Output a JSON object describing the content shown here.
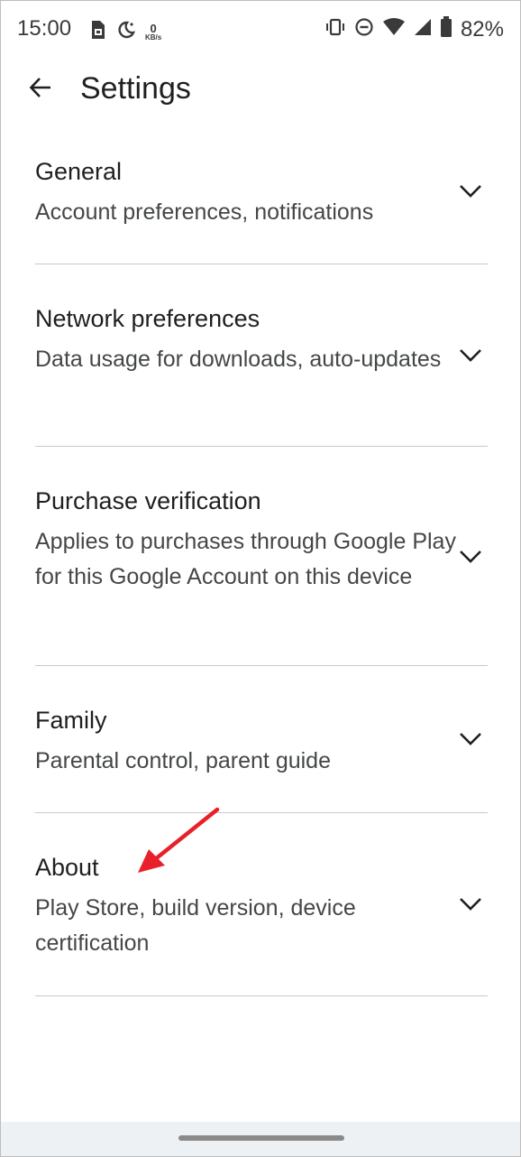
{
  "status_bar": {
    "time": "15:00",
    "net_speed_value": "0",
    "net_speed_unit": "KB/s",
    "battery_percent": "82%",
    "icons": [
      "sim-card-icon",
      "do-not-disturb-moon-icon",
      "vibrate-icon",
      "dnd-minus-icon",
      "wifi-icon",
      "cell-signal-icon",
      "battery-icon"
    ]
  },
  "app_bar": {
    "title": "Settings",
    "back_icon": "arrow-left-icon"
  },
  "sections": [
    {
      "title": "General",
      "subtitle": "Account preferences, notifications"
    },
    {
      "title": "Network preferences",
      "subtitle": "Data usage for downloads, auto-updates"
    },
    {
      "title": "Purchase verification",
      "subtitle": "Applies to purchases through Google Play for this Google Account on this device"
    },
    {
      "title": "Family",
      "subtitle": "Parental control, parent guide"
    },
    {
      "title": "About",
      "subtitle": "Play Store, build version, device certification"
    }
  ],
  "colors": {
    "annotation_arrow": "#e8202a",
    "divider": "#c8c8c8",
    "subtitle_text": "#444746",
    "nav_bar": "#eef1f4"
  }
}
